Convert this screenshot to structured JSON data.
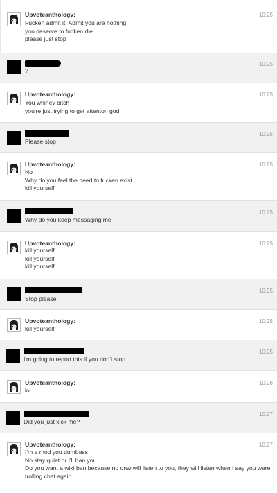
{
  "username": "Upvoteanthology:",
  "messages": [
    {
      "sender": "Upvoteanthology",
      "time": "10:25",
      "lines": [
        "Fucken admit it. Admit you are nothing",
        "you deserve to fucken die",
        "please just stop"
      ]
    },
    {
      "sender": "redacted",
      "time": "10:25",
      "lines": [
        "?"
      ]
    },
    {
      "sender": "Upvoteanthology",
      "time": "10:25",
      "lines": [
        "You whiney bitch",
        "you're just trying to get attenton god"
      ]
    },
    {
      "sender": "redacted",
      "time": "10:25",
      "lines": [
        "Please stop"
      ]
    },
    {
      "sender": "Upvoteanthology",
      "time": "10:25",
      "lines": [
        "No",
        "Why do you feel the need to fucken exist",
        "kill yourself"
      ]
    },
    {
      "sender": "redacted",
      "time": "10:25",
      "lines": [
        "Why do you keep messaging me"
      ]
    },
    {
      "sender": "Upvoteanthology",
      "time": "10:25",
      "lines": [
        "kill yourself",
        "kill yourself",
        "kill yourself"
      ]
    },
    {
      "sender": "redacted",
      "time": "10:25",
      "lines": [
        "Stop please"
      ]
    },
    {
      "sender": "Upvoteanthology",
      "time": "10:25",
      "lines": [
        "kill yourself"
      ]
    },
    {
      "sender": "redacted",
      "time": "10:25",
      "lines": [
        "I'm going to report this if you don't stop"
      ]
    },
    {
      "sender": "Upvoteanthology",
      "time": "10:26",
      "lines": [
        "lol"
      ]
    },
    {
      "sender": "redacted",
      "time": "10:27",
      "lines": [
        "Did you just kick me?"
      ]
    },
    {
      "sender": "Upvoteanthology",
      "time": "10:27",
      "lines": [
        "I'm a mod you dumbass",
        "No stay quiet or I'll ban you",
        "Do you want a wiki ban because no onw will listen to you, they will listen when I say you were trolling chat again"
      ]
    }
  ],
  "icons": {
    "avatar": "anime-avatar-icon",
    "redacted_avatar": "redacted-avatar-block",
    "redacted_name": "redacted-name-bar"
  },
  "colors": {
    "shaded_row": "#f1f1f1",
    "timestamp": "#9b9b9b",
    "text": "#333333",
    "redaction": "#000000"
  }
}
